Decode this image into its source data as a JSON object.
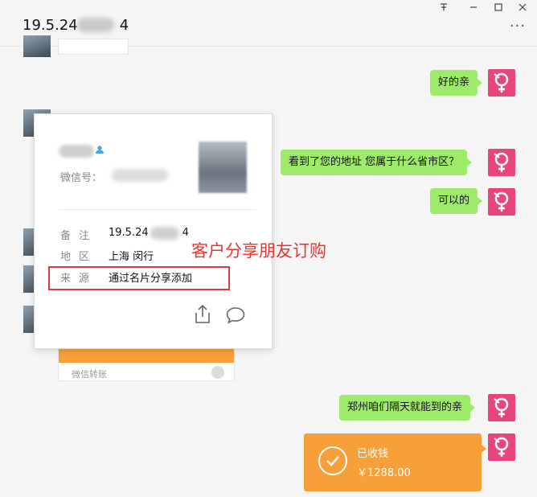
{
  "window": {
    "chat_title_prefix": "19.5.24",
    "chat_title_suffix": "4",
    "pin_icon": "平",
    "minimize_icon": "□-min",
    "maximize_icon": "□",
    "close_icon": "✕",
    "more_icon": "⋮"
  },
  "messages": [
    {
      "side": "right",
      "text": "好的亲"
    },
    {
      "side": "right",
      "text": "看到了您的地址 您属于什么省市区？"
    },
    {
      "side": "right",
      "text": "可以的"
    },
    {
      "side": "right",
      "text": "郑州咱们隔天就能到的亲"
    }
  ],
  "transfer_left": {
    "label": "微信转账"
  },
  "transfer_right": {
    "status": "已收钱",
    "amount": "￥1288.00"
  },
  "profile_card": {
    "wechat_id_label": "微信号：",
    "rows": [
      {
        "label": "备注",
        "value_prefix": "19.5.24",
        "value_suffix": "4"
      },
      {
        "label": "地区",
        "value": "上海 闵行"
      },
      {
        "label": "来源",
        "value": "通过名片分享添加"
      }
    ]
  },
  "annotation": "客户分享朋友订购",
  "colors": {
    "green_bubble": "#9eea6a",
    "transfer_orange": "#f7a03a",
    "avatar_pink": "#e8457c",
    "highlight_red": "#e03b3b"
  }
}
